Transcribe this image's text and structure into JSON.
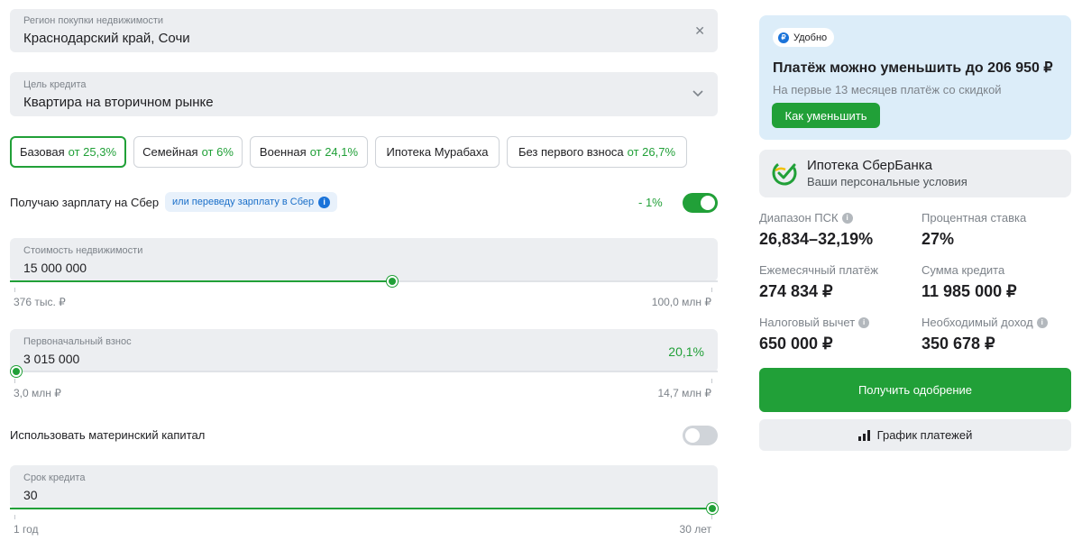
{
  "region": {
    "label": "Регион покупки недвижимости",
    "value": "Краснодарский край, Сочи",
    "clear_icon": "close-icon"
  },
  "purpose": {
    "label": "Цель кредита",
    "value": "Квартира на вторичном рынке",
    "dropdown_icon": "chevron-down-icon"
  },
  "programs": [
    {
      "name": "Базовая",
      "rate": "от 25,3%",
      "active": true
    },
    {
      "name": "Семейная",
      "rate": "от 6%",
      "active": false
    },
    {
      "name": "Военная",
      "rate": "от 24,1%",
      "active": false
    },
    {
      "name": "Ипотека Мурабаха",
      "rate": "",
      "active": false
    },
    {
      "name": "Без первого взноса",
      "rate": "от 26,7%",
      "active": false
    }
  ],
  "salary": {
    "label": "Получаю зарплату на Сбер",
    "hint": "или переведу зарплату в Сбер",
    "discount": "- 1%",
    "enabled": true
  },
  "property_cost": {
    "label": "Стоимость недвижимости",
    "value": "15 000 000",
    "min": "376 тыс. ₽",
    "max": "100,0 млн ₽",
    "slider_fraction": 0.54
  },
  "down_payment": {
    "label": "Первоначальный взнос",
    "value": "3 015 000",
    "percent": "20,1%",
    "min": "3,0 млн ₽",
    "max": "14,7 млн ₽",
    "slider_fraction": 0.0
  },
  "maternity": {
    "label": "Использовать материнский капитал",
    "enabled": false
  },
  "term": {
    "label": "Срок кредита",
    "value": "30",
    "min": "1 год",
    "max": "30 лет",
    "slider_fraction": 1.0
  },
  "promo": {
    "badge": "Удобно",
    "title": "Платёж можно уменьшить до 206 950 ₽",
    "subtitle": "На первые 13 месяцев платёж со скидкой",
    "button": "Как уменьшить"
  },
  "bank": {
    "name": "Ипотека СберБанка",
    "subtitle": "Ваши персональные условия",
    "logo_icon": "sber-logo-icon"
  },
  "stats": {
    "psk_label": "Диапазон ПСК",
    "psk_value": "26,834–32,19%",
    "rate_label": "Процентная ставка",
    "rate_value": "27%",
    "monthly_label": "Ежемесячный платёж",
    "monthly_value": "274 834 ₽",
    "loan_label": "Сумма кредита",
    "loan_value": "11 985 000 ₽",
    "tax_label": "Налоговый вычет",
    "tax_value": "650 000 ₽",
    "income_label": "Необходимый доход",
    "income_value": "350 678 ₽"
  },
  "actions": {
    "approve": "Получить одобрение",
    "schedule": "График платежей"
  },
  "colors": {
    "accent": "#21a038",
    "field_bg": "#eceef1",
    "promo_bg": "#dcedf9"
  }
}
